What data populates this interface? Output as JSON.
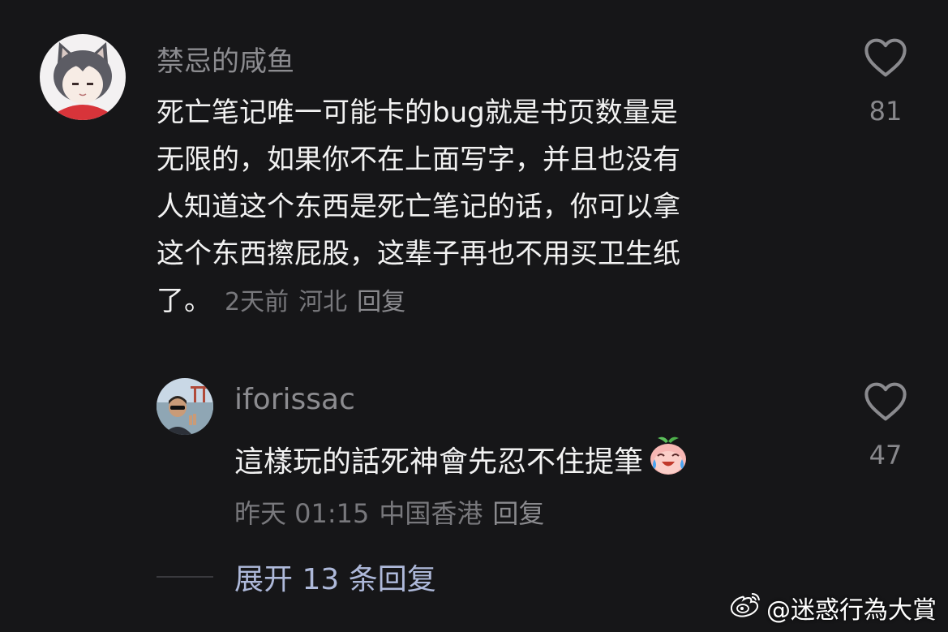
{
  "comments": [
    {
      "author": "禁忌的咸鱼",
      "lines": [
        "死亡笔记唯一可能卡的bug就是书页数量是",
        "无限的，如果你不在上面写字，并且也没有",
        "人知道这个东西是死亡笔记的话，你可以拿",
        "这个东西擦屁股，这辈子再也不用买卫生纸"
      ],
      "last_line": "了。",
      "time": "2天前",
      "location": "河北",
      "reply_label": "回复",
      "likes": "81"
    },
    {
      "author": "iforissac",
      "text": "這樣玩的話死神會先忍不住提筆",
      "emoji": "laugh-cry-peach-emoji",
      "time": "昨天 01:15",
      "location": "中国香港",
      "reply_label": "回复",
      "likes": "47"
    }
  ],
  "expand_replies": "展开 13 条回复",
  "watermark": "@迷惑行為大賞",
  "icons": {
    "like": "heart-outline-icon",
    "watermark_logo": "weibo-icon"
  },
  "colors": {
    "background": "#161618",
    "text": "#f2f2f2",
    "muted": "#78787c",
    "link": "#aeb9da"
  }
}
